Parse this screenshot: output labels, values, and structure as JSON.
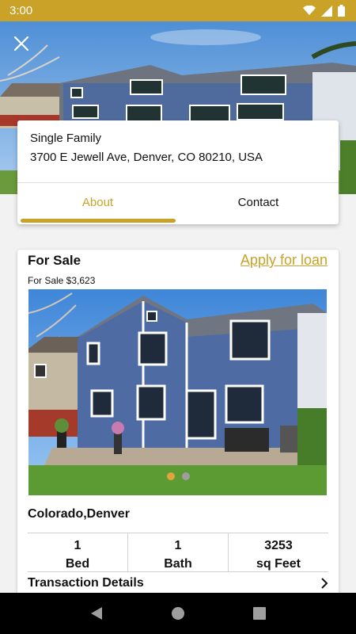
{
  "status_bar": {
    "time": "3:00"
  },
  "property": {
    "type": "Single Family",
    "address": "3700 E Jewell Ave, Denver, CO 80210, USA"
  },
  "tabs": [
    {
      "label": "About",
      "active": true
    },
    {
      "label": "Contact",
      "active": false
    }
  ],
  "listing": {
    "status": "For Sale",
    "price_text": "For Sale $3,623",
    "apply_label": "Apply for loan",
    "location": "Colorado,Denver",
    "stats": [
      {
        "value": "1",
        "label": "Bed"
      },
      {
        "value": "1",
        "label": "Bath"
      },
      {
        "value": "3253",
        "label": "sq Feet"
      }
    ],
    "details_label": "Transaction Details",
    "photo_pages": {
      "current": 1,
      "total": 2
    }
  },
  "colors": {
    "accent": "#c9a227",
    "nav": "#000000",
    "dot_active": "#e0a53a",
    "dot_inactive": "#9e9e9e"
  },
  "icons": {
    "close": "close-icon",
    "wifi": "wifi-icon",
    "signal": "signal-icon",
    "battery": "battery-icon",
    "chevron": "chevron-right-icon",
    "back": "back-icon",
    "home": "home-icon",
    "recents": "recents-icon"
  }
}
